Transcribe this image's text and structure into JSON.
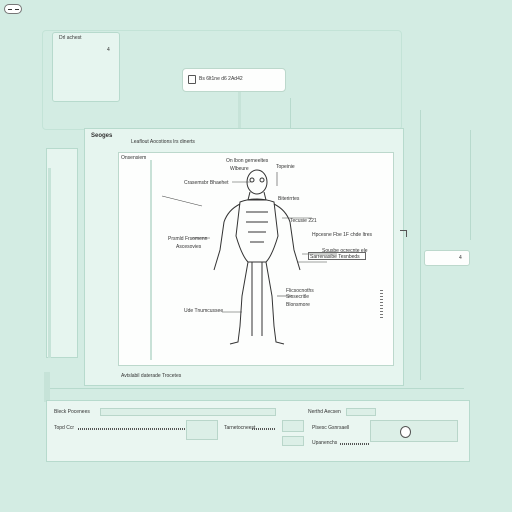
{
  "top_left_panel": {
    "title": "Drl achest",
    "marker": "4"
  },
  "top_pill": {
    "text": "Bs 6lt1ne d6 2Ad42"
  },
  "window": {
    "title": "Seoges",
    "header_text": "Leaflout Aocotions lrs dinerts",
    "panel_label": "Onsensiem",
    "footer_text": "Avtslabil daterade Trocetes"
  },
  "figure_labels": {
    "top": "On lbon gerneeltes",
    "top_sub": "Wlbeure",
    "top_right": "Topeinie",
    "head_left": "Crasemsbr Bhaehet",
    "right_shoulder": "Biterirrtes",
    "right_mid": "Tecusie 221",
    "left_mid": "Prsmld Frsomenn",
    "left_mid_sub": "Ascesovies",
    "right_callout_1": "Hpcesne Fbe 1F chde ltres",
    "right_callout_2": "Sousbe ocrecnte ele",
    "right_callout_3": "Sarrenasibe Tesnbeds",
    "lower_right_1": "Flicsocnoths",
    "lower_right_2": "Siosecritle",
    "lower_right_3": "Blonsmore",
    "lower_left": "Ude Tnumcussee"
  },
  "side_tab": {
    "marker": "4"
  },
  "bottom_panel": {
    "left_title": "Bleck Pocenees",
    "left_field": "Topd Ccr",
    "mid_field": "Tarnetocneest",
    "right_title": "Nerthd Aecsen",
    "right_field_1": "Plsesc Gsnrsaell",
    "right_field_2": "Upanenchs"
  }
}
